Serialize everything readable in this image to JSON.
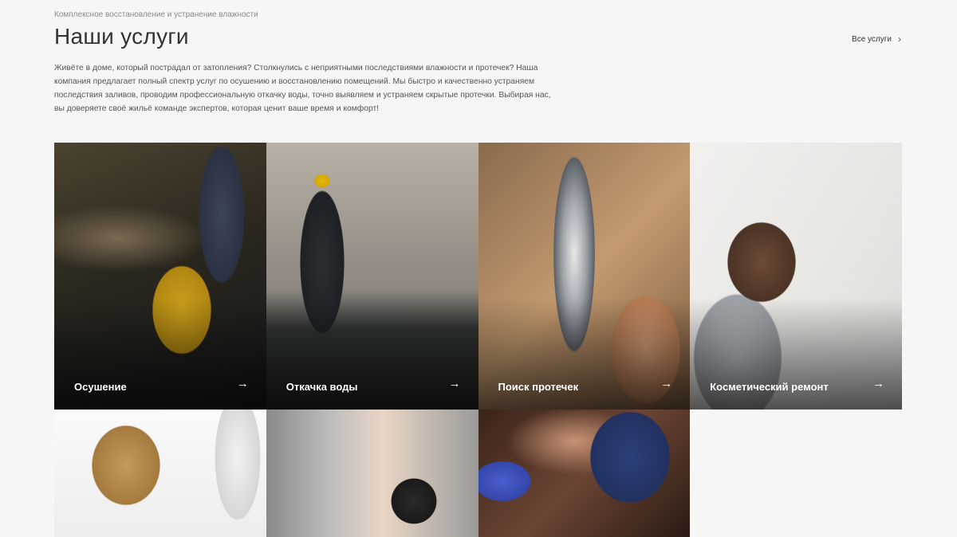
{
  "header": {
    "eyebrow": "Комплексное восстановление и устранение влажности",
    "title": "Наши услуги",
    "all_link": "Все услуги",
    "all_link_icon": "chevron-right-icon"
  },
  "description": "Живёте в доме, который пострадал от затопления? Столкнулись с неприятными последствиями влажности и протечек? Наша компания предлагает полный спектр услуг по осушению и восстановлению помещений. Мы быстро и качественно устраняем последствия заливов, проводим профессиональную откачку воды, точно выявляем и устраняем скрытые протечки. Выбирая нас, вы доверяете своё жильё команде экспертов, которая ценит ваше время и комфорт!",
  "services": [
    {
      "label": "Осушение",
      "image": "rubber-boots-in-water"
    },
    {
      "label": "Откачка воды",
      "image": "worker-pumping-water"
    },
    {
      "label": "Поиск протечек",
      "image": "wrench-on-pipe"
    },
    {
      "label": "Косметический ремонт",
      "image": "man-plastering-wall"
    },
    {
      "label": "",
      "image": "worker-in-protective-suit"
    },
    {
      "label": "",
      "image": "plumber-at-boiler"
    },
    {
      "label": "",
      "image": "gloved-hands-cleaning"
    }
  ],
  "icons": {
    "card_arrow": "arrow-right-icon"
  },
  "colors": {
    "background": "#f6f6f6",
    "title": "#333333",
    "label": "#ffffff"
  }
}
